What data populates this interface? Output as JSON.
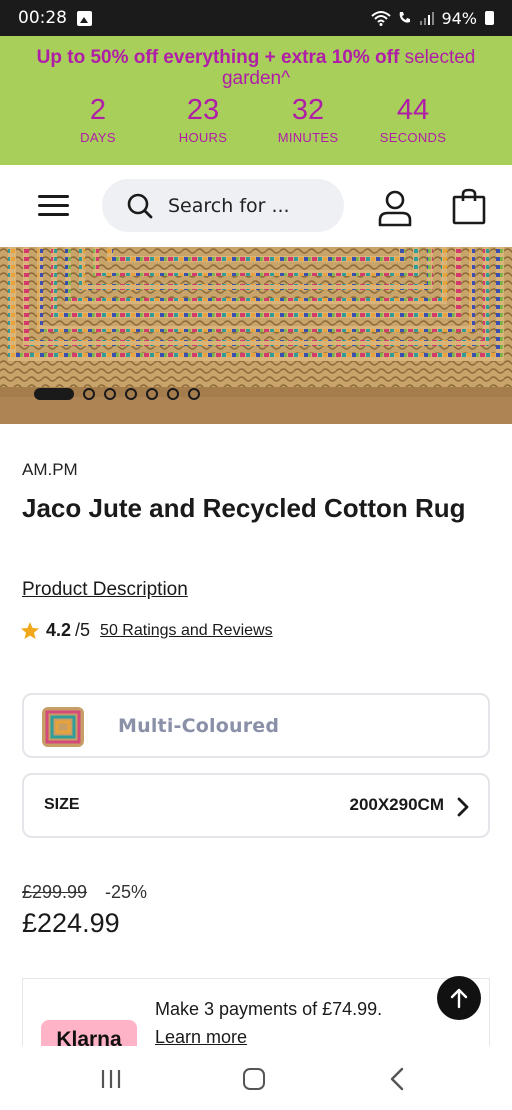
{
  "status_bar": {
    "time": "00:28",
    "battery": "94%"
  },
  "promo": {
    "bold_text": "Up to 50% off everything + extra 10% off",
    "rest_text": " selected garden^",
    "countdown": [
      {
        "value": "2",
        "label": "DAYS"
      },
      {
        "value": "23",
        "label": "HOURS"
      },
      {
        "value": "32",
        "label": "MINUTES"
      },
      {
        "value": "44",
        "label": "SECONDS"
      }
    ],
    "accent_color": "#b01ea8",
    "background_color": "#a8cf5a"
  },
  "header": {
    "search_placeholder": "Search for ..."
  },
  "carousel": {
    "total_slides": 7,
    "active_index": 0
  },
  "product": {
    "brand": "AM.PM",
    "title": "Jaco Jute and Recycled Cotton Rug",
    "description_link": "Product Description",
    "rating": {
      "value": "4.2",
      "max": "/5",
      "reviews_link": "50 Ratings and Reviews",
      "stars_value": 4.2
    },
    "colour": {
      "label": "Multi-Coloured"
    },
    "size": {
      "label": "SIZE",
      "value": "200X290CM"
    },
    "price": {
      "old": "£299.99",
      "discount": "-25%",
      "current": "£224.99"
    }
  },
  "klarna": {
    "badge": "Klarna",
    "text": "Make 3 payments of £74.99.",
    "link": "Learn more"
  },
  "icons": [
    "menu-icon",
    "search-icon",
    "account-icon",
    "bag-icon",
    "star-icon",
    "chevron-right-icon",
    "arrow-up-icon"
  ]
}
